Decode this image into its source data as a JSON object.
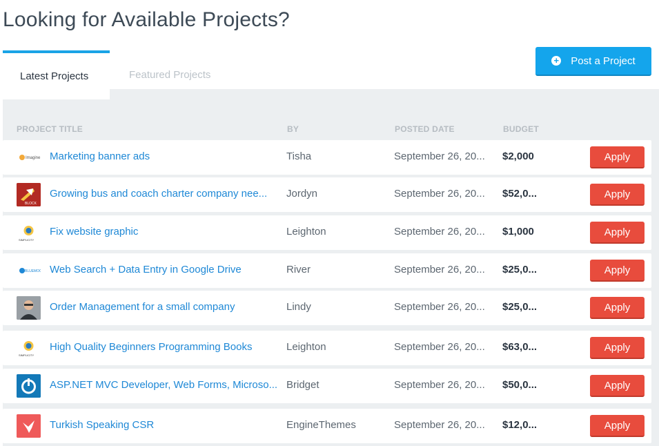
{
  "page_title": "Looking for Available Projects?",
  "tabs": [
    {
      "label": "Latest Projects",
      "active": true
    },
    {
      "label": "Featured Projects",
      "active": false
    }
  ],
  "post_button": {
    "label": "Post a Project",
    "icon": "plus-circle-icon"
  },
  "columns": {
    "title": "PROJECT TITLE",
    "by": "BY",
    "date": "POSTED DATE",
    "budget": "BUDGET"
  },
  "apply_label": "Apply",
  "colors": {
    "accent": "#14a5ec",
    "apply": "#e84c3d",
    "link": "#1e88d6"
  },
  "rows": [
    {
      "title": "Marketing banner ads",
      "by": "Tisha",
      "date": "September 26, 20...",
      "budget": "$2,000",
      "thumb": "imagine-logo",
      "thumb_text": "Imagine"
    },
    {
      "title": "Growing bus and coach charter company nee...",
      "by": "Jordyn",
      "date": "September 26, 20...",
      "budget": "$52,0...",
      "thumb": "block-logo",
      "thumb_text": "BLOCK"
    },
    {
      "title": "Fix website graphic",
      "by": "Leighton",
      "date": "September 26, 20...",
      "budget": "$1,000",
      "thumb": "simplicity-logo",
      "thumb_text": "SIMPLICITY"
    },
    {
      "title": "Web Search + Data Entry in Google Drive",
      "by": "River",
      "date": "September 26, 20...",
      "budget": "$25,0...",
      "thumb": "blue-logo",
      "thumb_text": "BLUEMOON"
    },
    {
      "title": "Order Management for a small company",
      "by": "Lindy",
      "date": "September 26, 20...",
      "budget": "$25,0...",
      "thumb": "person-avatar",
      "thumb_text": ""
    },
    {
      "title": "High Quality Beginners Programming Books",
      "by": "Leighton",
      "date": "September 26, 20...",
      "budget": "$63,0...",
      "thumb": "simplicity-logo",
      "thumb_text": "SIMPLICITY"
    },
    {
      "title": "ASP.NET MVC Developer, Web Forms, Microso...",
      "by": "Bridget",
      "date": "September 26, 20...",
      "budget": "$50,0...",
      "thumb": "power-logo",
      "thumb_text": ""
    },
    {
      "title": "Turkish Speaking CSR",
      "by": "EngineThemes",
      "date": "September 26, 20...",
      "budget": "$12,0...",
      "thumb": "bird-logo",
      "thumb_text": ""
    }
  ]
}
